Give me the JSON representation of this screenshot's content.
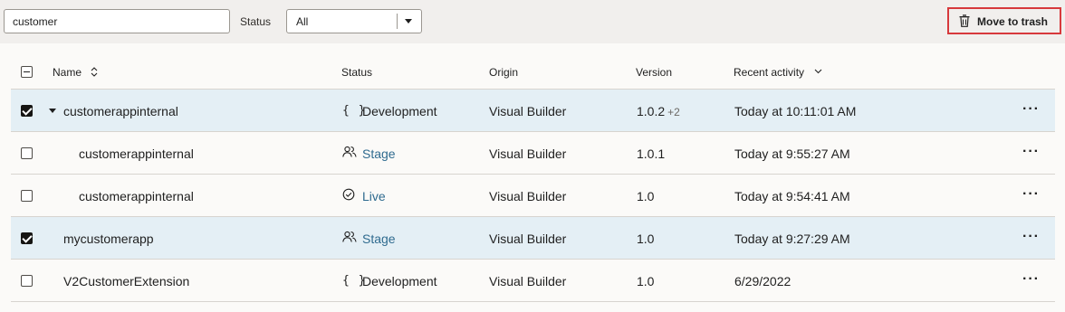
{
  "toolbar": {
    "search_value": "customer",
    "status_label": "Status",
    "status_select_value": "All",
    "trash_button_label": "Move to trash"
  },
  "table": {
    "headers": {
      "name": "Name",
      "status": "Status",
      "origin": "Origin",
      "version": "Version",
      "recent_activity": "Recent activity"
    },
    "rows": [
      {
        "checked": true,
        "name": "customerappinternal",
        "expandable": true,
        "child": false,
        "status": "Development",
        "status_icon": "braces-icon",
        "status_link": false,
        "origin": "Visual Builder",
        "version": "1.0.2",
        "version_extra": "+2",
        "activity": "Today at 10:11:01 AM"
      },
      {
        "checked": false,
        "name": "customerappinternal",
        "expandable": false,
        "child": true,
        "status": "Stage",
        "status_icon": "users-icon",
        "status_link": true,
        "origin": "Visual Builder",
        "version": "1.0.1",
        "version_extra": "",
        "activity": "Today at 9:55:27 AM"
      },
      {
        "checked": false,
        "name": "customerappinternal",
        "expandable": false,
        "child": true,
        "status": "Live",
        "status_icon": "check-circle-icon",
        "status_link": true,
        "origin": "Visual Builder",
        "version": "1.0",
        "version_extra": "",
        "activity": "Today at 9:54:41 AM"
      },
      {
        "checked": true,
        "name": "mycustomerapp",
        "expandable": false,
        "child": false,
        "status": "Stage",
        "status_icon": "users-icon",
        "status_link": true,
        "origin": "Visual Builder",
        "version": "1.0",
        "version_extra": "",
        "activity": "Today at 9:27:29 AM"
      },
      {
        "checked": false,
        "name": "V2CustomerExtension",
        "expandable": false,
        "child": false,
        "status": "Development",
        "status_icon": "braces-icon",
        "status_link": false,
        "origin": "Visual Builder",
        "version": "1.0",
        "version_extra": "",
        "activity": "6/29/2022"
      }
    ]
  }
}
